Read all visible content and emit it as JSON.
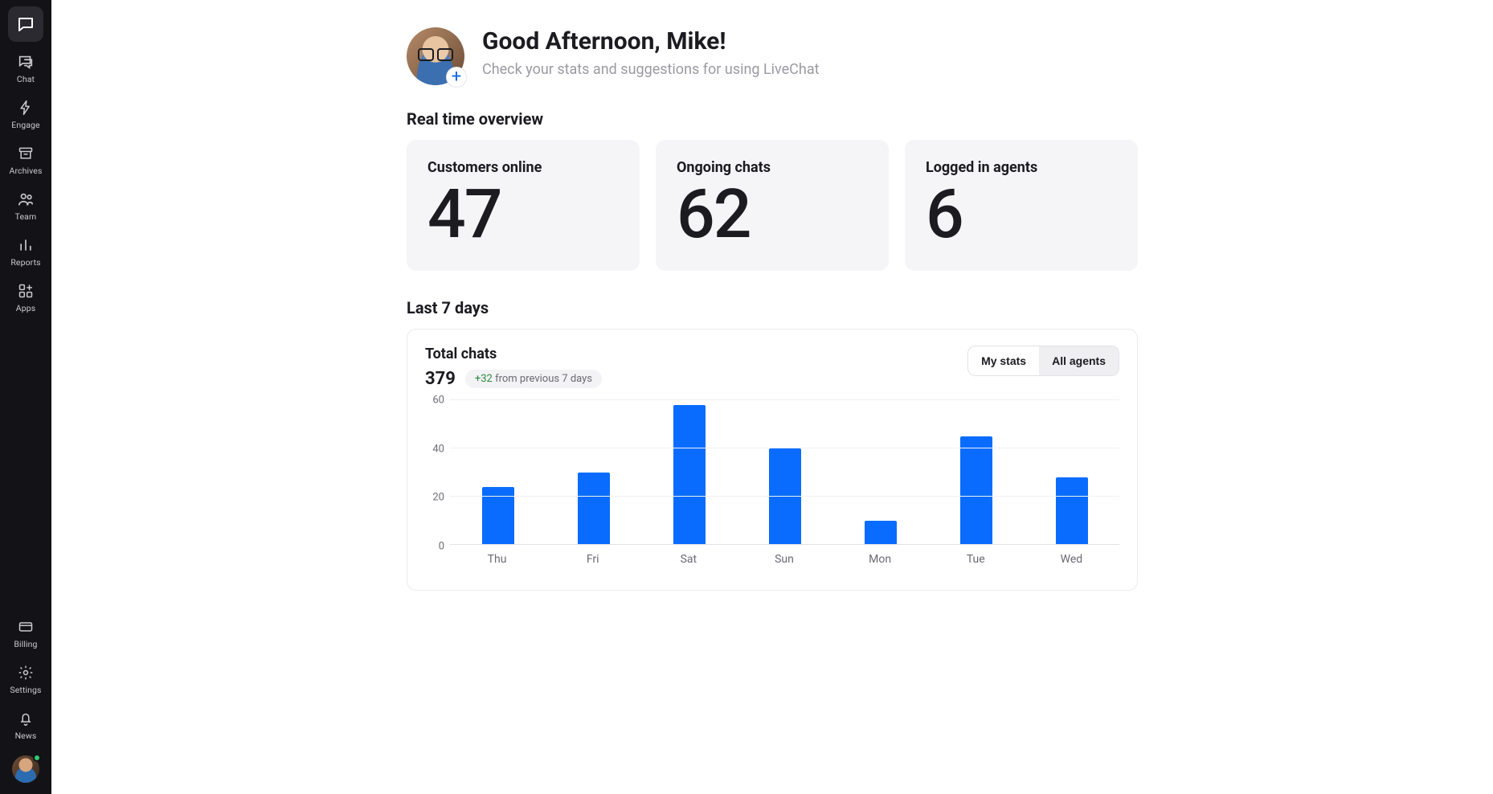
{
  "sidebar": {
    "items": [
      {
        "label": "Chat"
      },
      {
        "label": "Engage"
      },
      {
        "label": "Archives"
      },
      {
        "label": "Team"
      },
      {
        "label": "Reports"
      },
      {
        "label": "Apps"
      }
    ],
    "bottom": [
      {
        "label": "Billing"
      },
      {
        "label": "Settings"
      },
      {
        "label": "News"
      }
    ]
  },
  "header": {
    "greeting": "Good Afternoon, Mike!",
    "subtitle": "Check your stats and suggestions for using LiveChat"
  },
  "overview": {
    "title": "Real time overview",
    "cards": [
      {
        "title": "Customers online",
        "value": "47"
      },
      {
        "title": "Ongoing chats",
        "value": "62"
      },
      {
        "title": "Logged in agents",
        "value": "6"
      }
    ]
  },
  "last7": {
    "title": "Last 7 days",
    "panel_title": "Total chats",
    "total": "379",
    "delta": "+32",
    "delta_suffix": " from previous 7 days",
    "seg": {
      "left": "My stats",
      "right": "All agents",
      "active": "right"
    }
  },
  "chart_data": {
    "type": "bar",
    "categories": [
      "Thu",
      "Fri",
      "Sat",
      "Sun",
      "Mon",
      "Tue",
      "Wed"
    ],
    "values": [
      24,
      30,
      58,
      40,
      10,
      45,
      28
    ],
    "y_ticks": [
      0,
      20,
      40,
      60
    ],
    "ylim": [
      0,
      60
    ],
    "title": "Total chats",
    "xlabel": "",
    "ylabel": "",
    "color": "#0a6cff"
  }
}
